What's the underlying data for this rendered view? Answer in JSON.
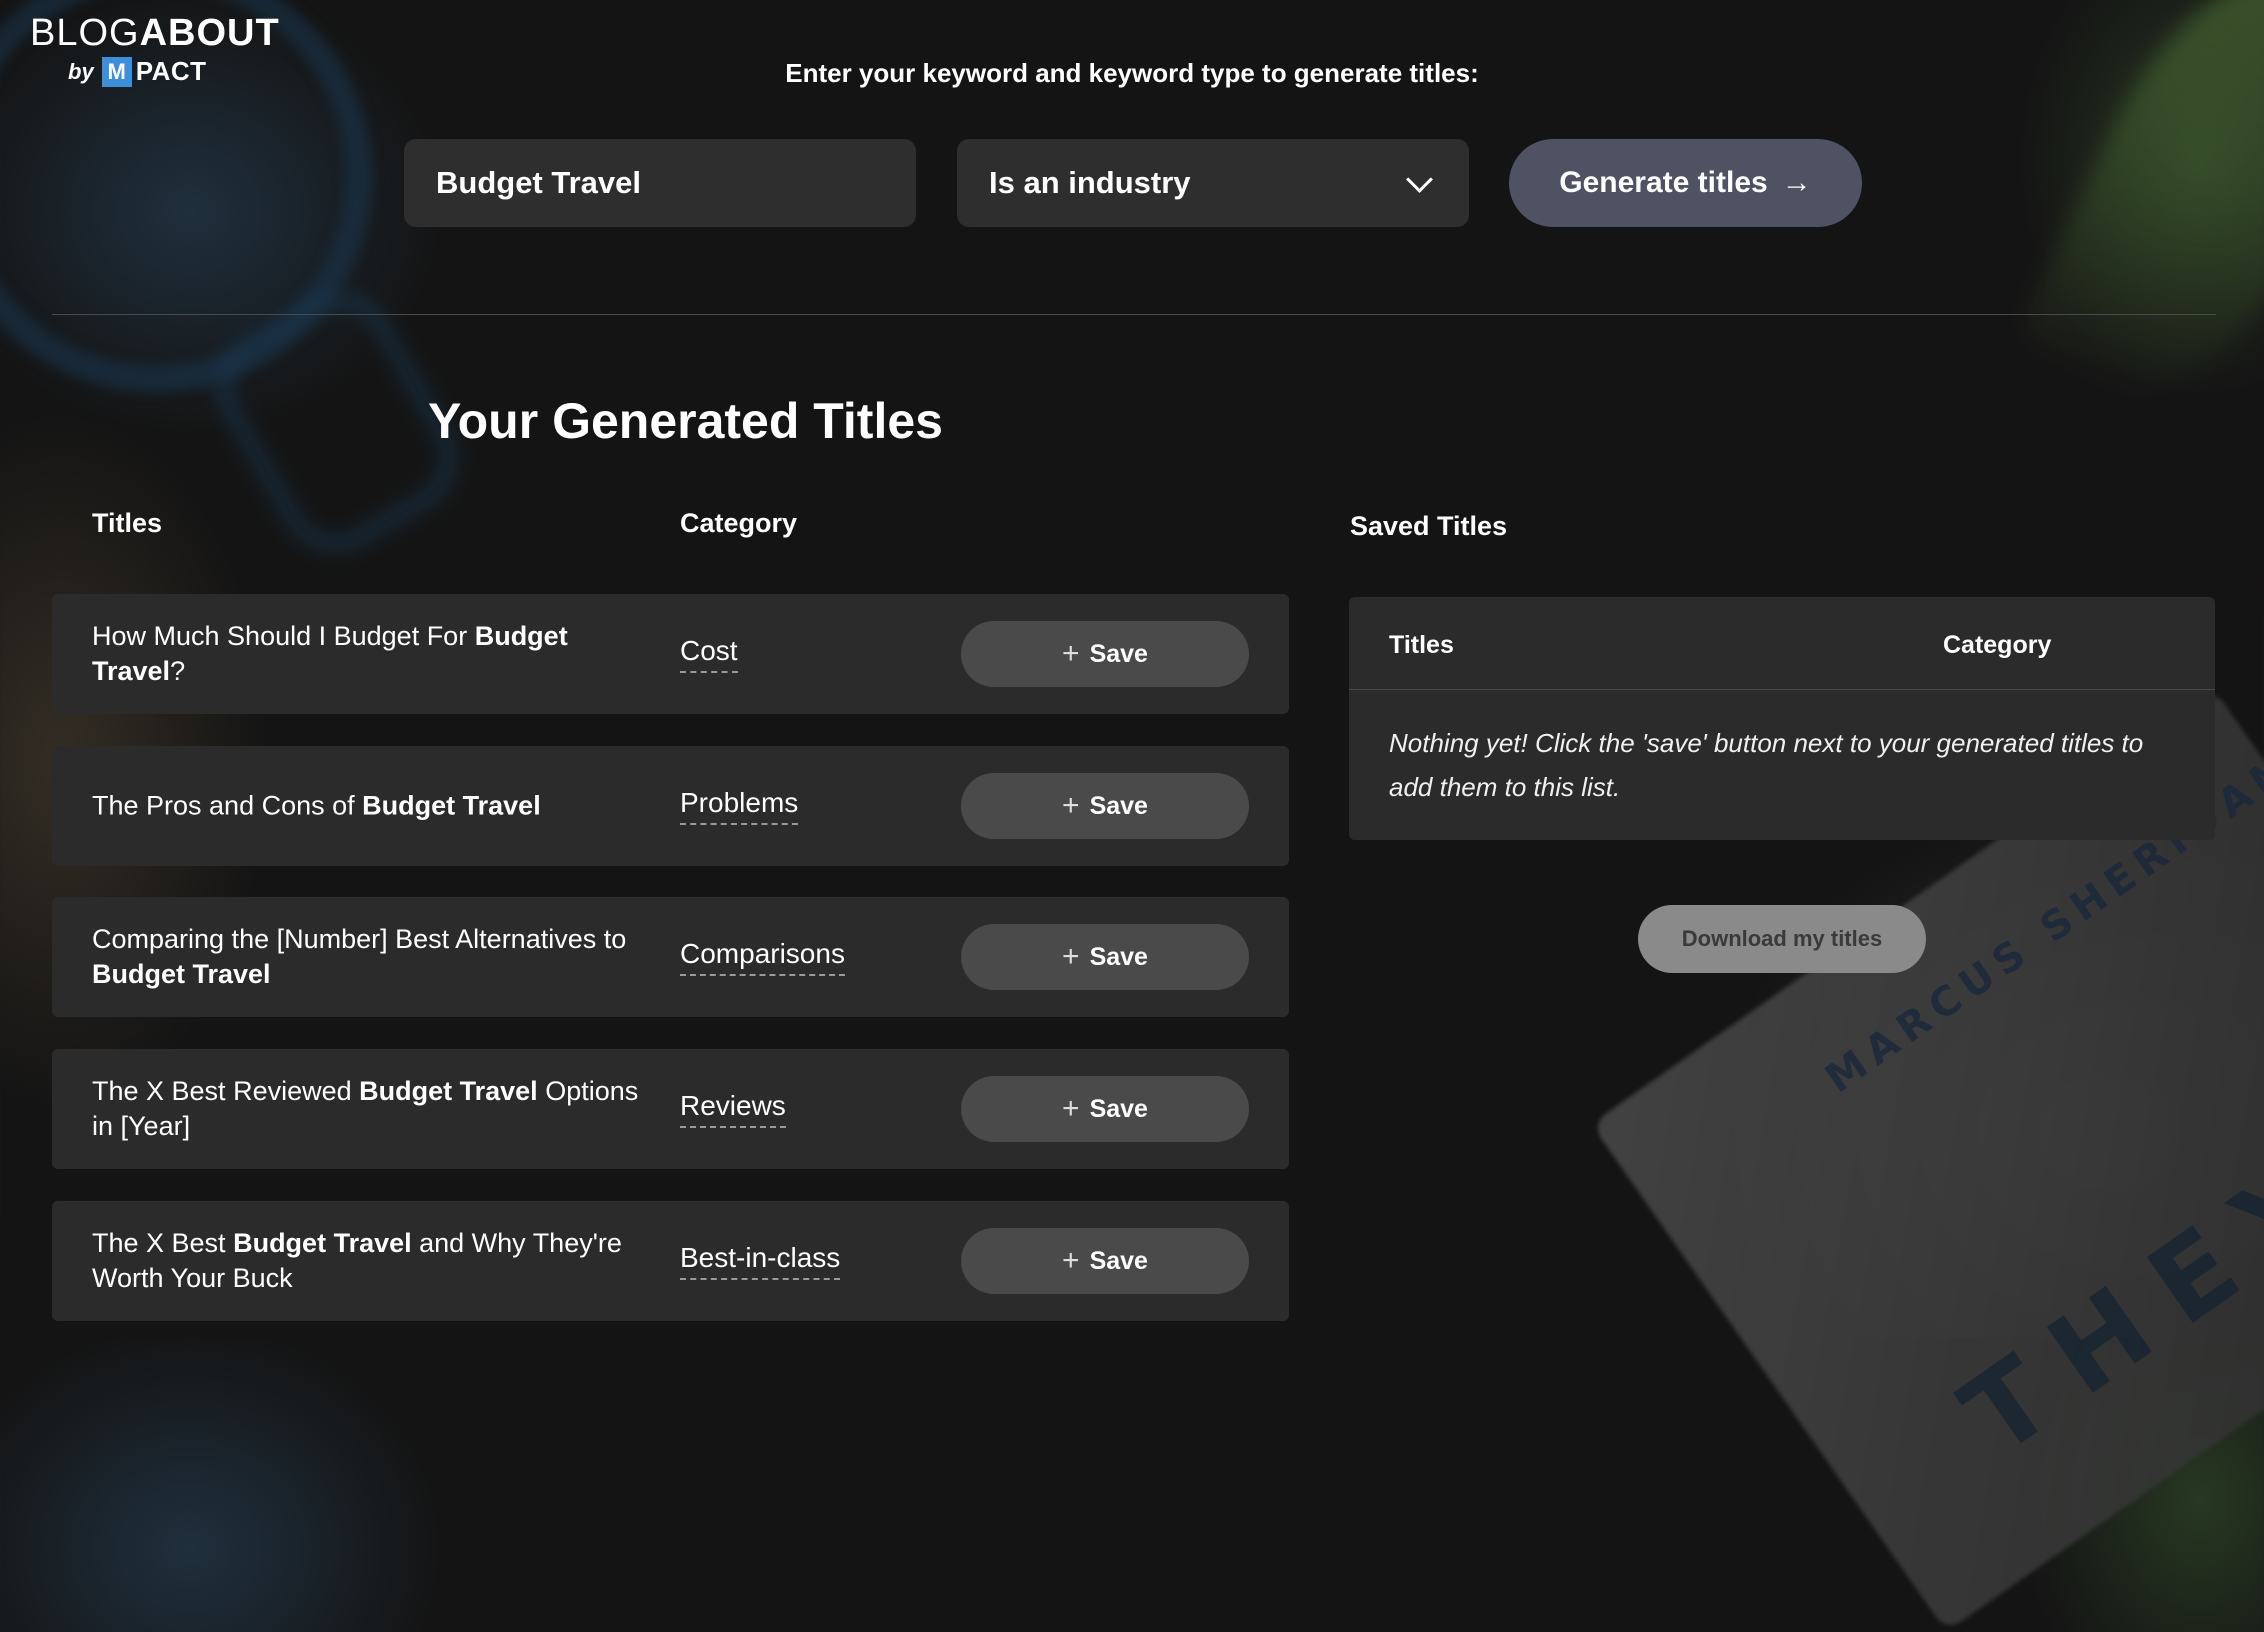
{
  "logo": {
    "brand_thin": "BLOG",
    "brand_bold": "ABOUT",
    "by": "by",
    "mark": "M",
    "mark_rest": "PACT"
  },
  "prompt": "Enter your keyword and keyword type to generate titles:",
  "keyword": {
    "value": "Budget Travel"
  },
  "keyword_type": {
    "selected": "Is an industry"
  },
  "generate_button": {
    "label": "Generate titles",
    "icon": "arrow-right-icon"
  },
  "section_title": "Your Generated Titles",
  "columns": {
    "titles": "Titles",
    "category": "Category"
  },
  "rows": [
    {
      "pre": "How Much Should I Budget For ",
      "keyword": "Budget Travel",
      "post": "?",
      "category": "Cost",
      "save": "Save"
    },
    {
      "pre": "The Pros and Cons of ",
      "keyword": "Budget Travel",
      "post": "",
      "category": "Problems",
      "save": "Save"
    },
    {
      "pre": "Comparing the [Number] Best Alternatives to ",
      "keyword": "Budget Travel",
      "post": "",
      "category": "Comparisons",
      "save": "Save"
    },
    {
      "pre": "The X Best Reviewed ",
      "keyword": "Budget Travel",
      "post": " Options in [Year]",
      "category": "Reviews",
      "save": "Save"
    },
    {
      "pre": "The X Best ",
      "keyword": "Budget Travel",
      "post": " and Why They're Worth Your Buck",
      "category": "Best-in-class",
      "save": "Save"
    }
  ],
  "saved": {
    "heading": "Saved Titles",
    "col_titles": "Titles",
    "col_category": "Category",
    "empty_message": "Nothing yet! Click the 'save' button next to your generated titles to add them to this list."
  },
  "download_button": "Download my titles",
  "background": {
    "book_author": "MARCUS SHERIDAN",
    "book_title": "THEY ASK"
  }
}
